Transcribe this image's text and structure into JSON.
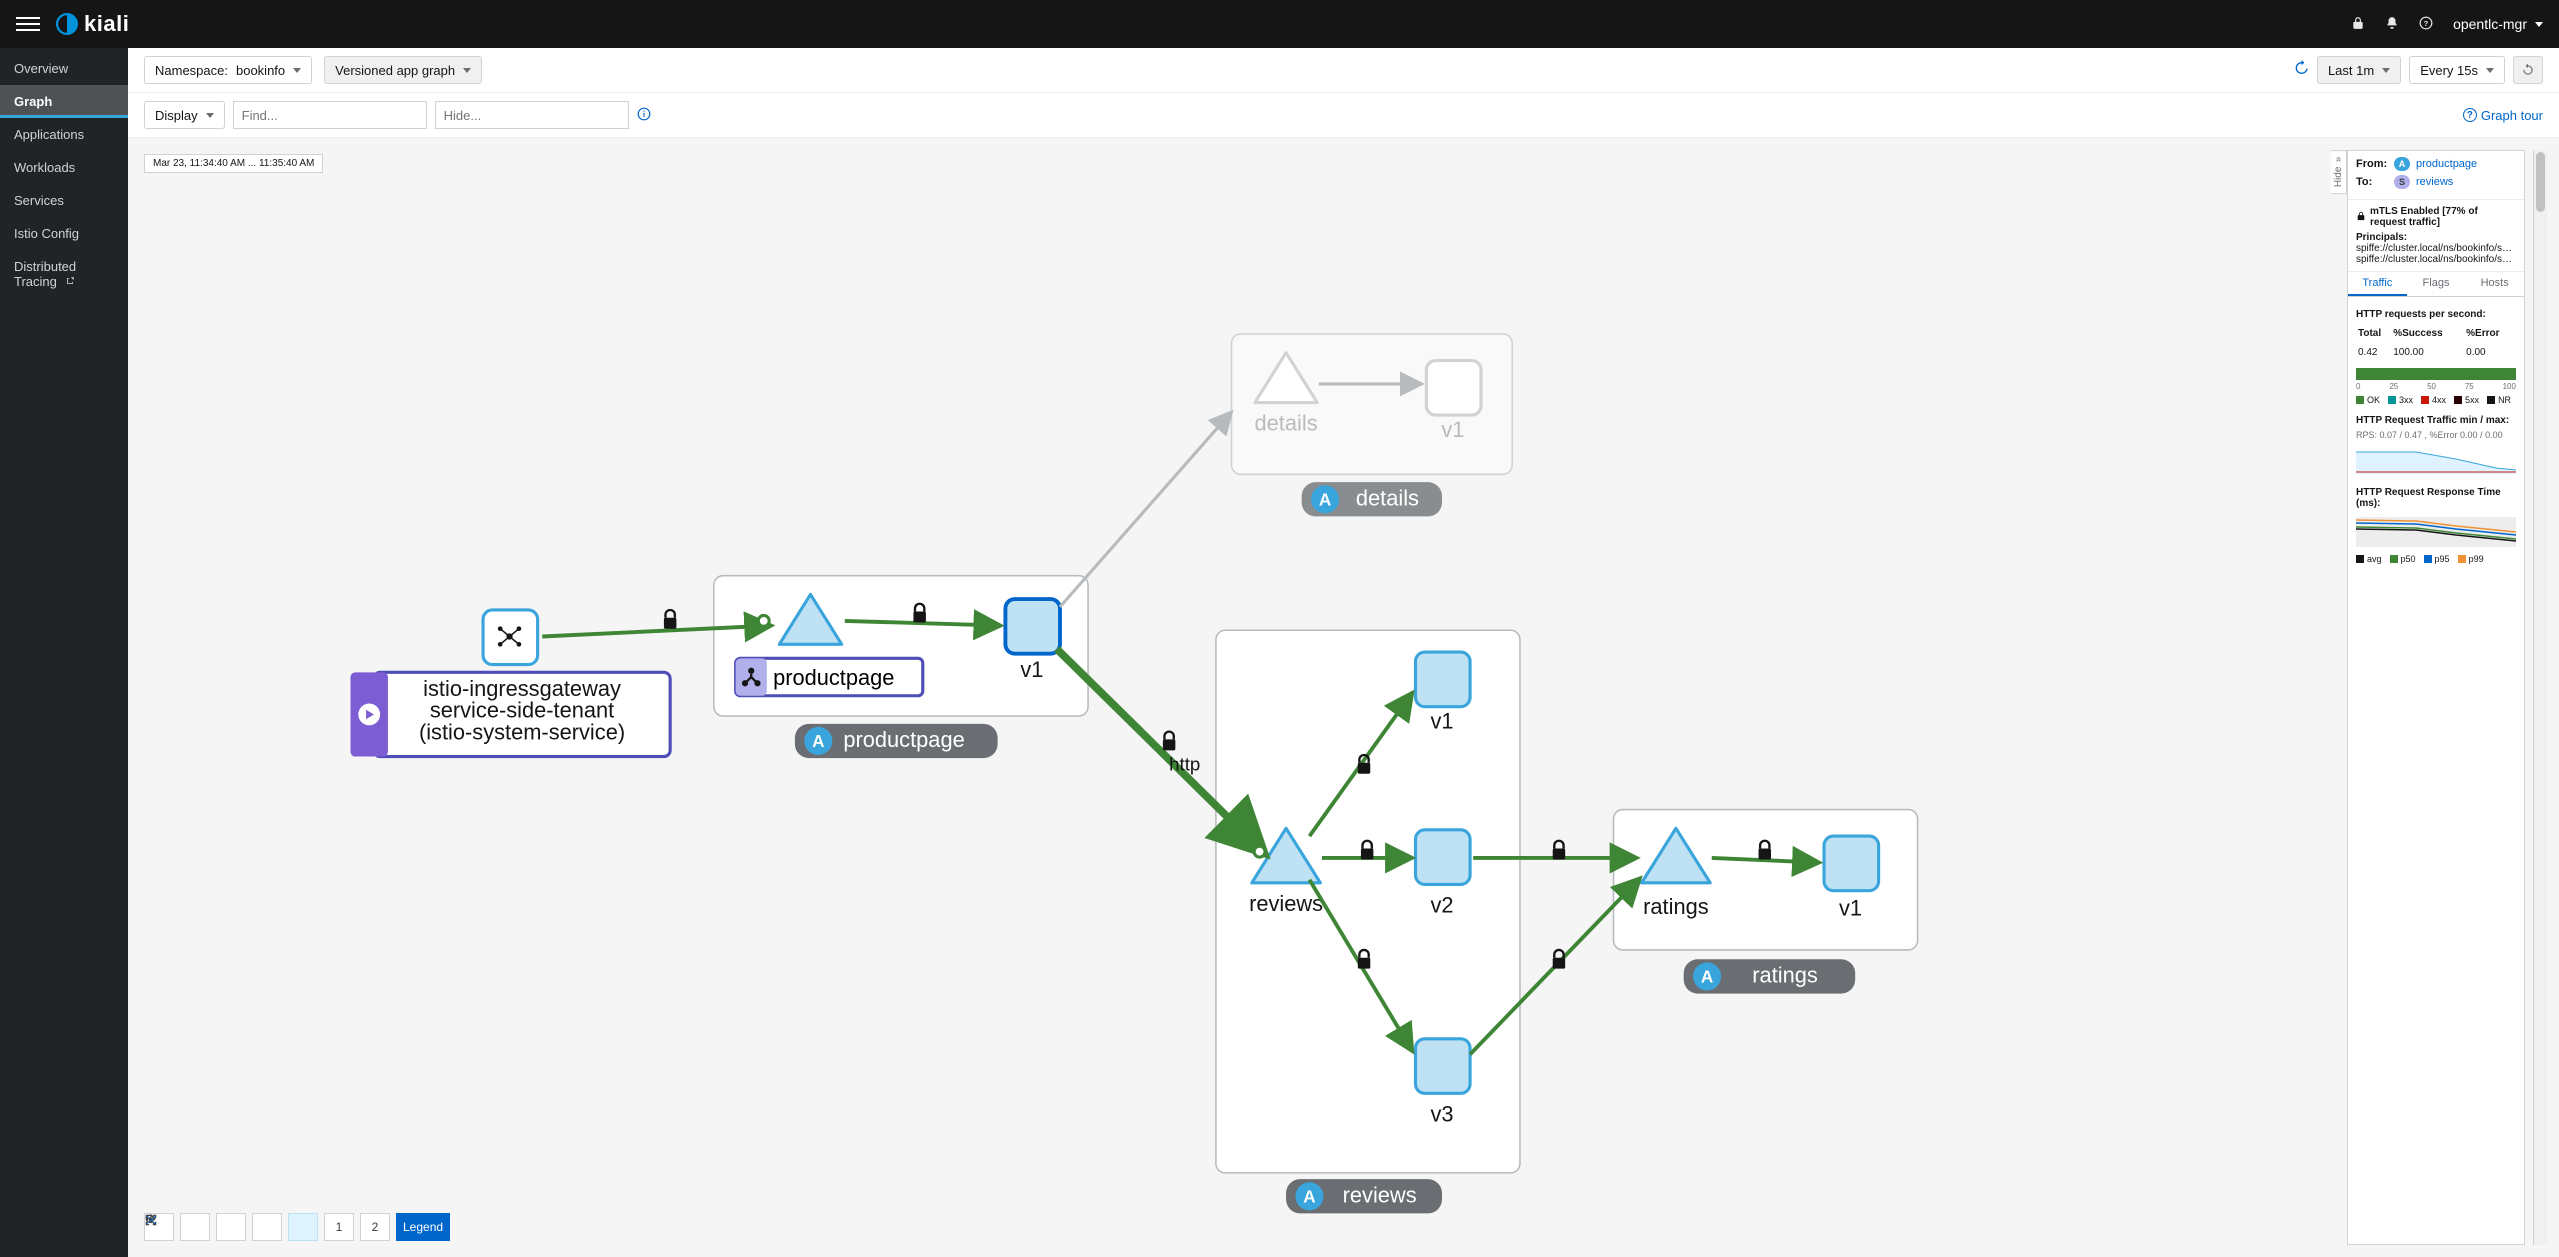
{
  "app": {
    "name": "kiali"
  },
  "topbar": {
    "user": "opentlc-mgr",
    "icons": [
      "lock-icon",
      "bell-icon",
      "help-icon"
    ]
  },
  "sidebar": {
    "items": [
      {
        "label": "Overview",
        "key": "overview"
      },
      {
        "label": "Graph",
        "key": "graph",
        "active": true
      },
      {
        "label": "Applications",
        "key": "applications"
      },
      {
        "label": "Workloads",
        "key": "workloads"
      },
      {
        "label": "Services",
        "key": "services"
      },
      {
        "label": "Istio Config",
        "key": "istio-config"
      },
      {
        "label": "Distributed Tracing",
        "key": "distributed-tracing",
        "external": true
      }
    ]
  },
  "toolbar": {
    "namespace_label": "Namespace:",
    "namespace_value": "bookinfo",
    "graph_type": "Versioned app graph",
    "display_label": "Display",
    "find_placeholder": "Find...",
    "hide_placeholder": "Hide...",
    "time_range": "Last 1m",
    "refresh_interval": "Every 15s",
    "graph_tour": "Graph tour"
  },
  "canvas": {
    "timestamp_text": "Mar 23, 11:34:40 AM ... 11:35:40 AM",
    "ingress": {
      "line1": "istio-ingressgateway",
      "line2": "service-side-tenant",
      "line3": "(istio-system-service)"
    },
    "productpage": {
      "service_label": "productpage",
      "v1": "v1",
      "group": "productpage"
    },
    "details": {
      "service_label": "details",
      "v1": "v1",
      "group": "details"
    },
    "reviews": {
      "service_label": "reviews",
      "v1": "v1",
      "v2": "v2",
      "v3": "v3",
      "group": "reviews"
    },
    "ratings": {
      "service_label": "ratings",
      "v1": "v1",
      "group": "ratings"
    },
    "edge_http_label": "http",
    "badge_a": "A",
    "badge_s": "S",
    "bottom_toolbar": {
      "legend": "Legend",
      "layout1_suffix": "1",
      "layout2_suffix": "2"
    }
  },
  "sidepanel": {
    "hide_label": "Hide",
    "from_label": "From:",
    "to_label": "To:",
    "from_value": "productpage",
    "to_value": "reviews",
    "from_badge": "A",
    "to_badge": "S",
    "mtls_text": "mTLS Enabled [77% of request traffic]",
    "principals_label": "Principals:",
    "principals": [
      "spiffe://cluster.local/ns/bookinfo/sa/bookinfo...",
      "spiffe://cluster.local/ns/bookinfo/sa/bookinfo..."
    ],
    "tabs": [
      {
        "label": "Traffic",
        "active": true
      },
      {
        "label": "Flags",
        "active": false
      },
      {
        "label": "Hosts",
        "active": false
      }
    ],
    "traffic": {
      "title": "HTTP requests per second:",
      "headers": {
        "total": "Total",
        "success": "%Success",
        "error": "%Error"
      },
      "row": {
        "total": "0.42",
        "success": "100.00",
        "error": "0.00"
      },
      "xaxis": [
        "0",
        "25",
        "50",
        "75",
        "100"
      ],
      "legend_codes": [
        {
          "label": "OK",
          "color": "#3e8635"
        },
        {
          "label": "3xx",
          "color": "#009596"
        },
        {
          "label": "4xx",
          "color": "#c9190b"
        },
        {
          "label": "5xx",
          "color": "#2b0000"
        },
        {
          "label": "NR",
          "color": "#151515"
        }
      ],
      "minmax_title": "HTTP Request Traffic min / max:",
      "minmax_sub": "RPS: 0.07 / 0.47 , %Error 0.00 / 0.00",
      "rt_title": "HTTP Request Response Time (ms):",
      "rt_legend": [
        {
          "label": "avg",
          "color": "#151515"
        },
        {
          "label": "p50",
          "color": "#3e8635"
        },
        {
          "label": "p95",
          "color": "#0066cc"
        },
        {
          "label": "p99",
          "color": "#ef9234"
        }
      ]
    }
  },
  "chart_data": [
    {
      "type": "bar",
      "title": "HTTP requests per second: distribution",
      "orientation": "horizontal-stacked-percent",
      "categories": [
        "OK",
        "3xx",
        "4xx",
        "5xx",
        "NR"
      ],
      "values": [
        100,
        0,
        0,
        0,
        0
      ],
      "xlim": [
        0,
        100
      ],
      "xticks": [
        0,
        25,
        50,
        75,
        100
      ]
    },
    {
      "type": "area",
      "title": "HTTP Request Traffic min / max",
      "ylabel": "RPS",
      "series": [
        {
          "name": "RPS",
          "values": [
            0.45,
            0.45,
            0.44,
            0.42,
            0.38,
            0.3,
            0.2,
            0.12,
            0.09,
            0.08
          ]
        }
      ],
      "x_relative_minutes": [
        -1.0,
        -0.9,
        -0.8,
        -0.7,
        -0.6,
        -0.5,
        -0.4,
        -0.3,
        -0.2,
        -0.1
      ],
      "ymin_line": 0.07,
      "ymax_line": 0.47
    },
    {
      "type": "line",
      "title": "HTTP Request Response Time (ms)",
      "series": [
        {
          "name": "avg",
          "values": [
            28,
            28,
            27,
            26,
            24,
            22,
            20,
            19,
            18,
            18
          ]
        },
        {
          "name": "p50",
          "values": [
            27,
            27,
            26,
            25,
            23,
            21,
            19,
            18,
            17,
            17
          ]
        },
        {
          "name": "p95",
          "values": [
            42,
            42,
            41,
            40,
            37,
            34,
            31,
            29,
            28,
            27
          ]
        },
        {
          "name": "p99",
          "values": [
            55,
            55,
            54,
            53,
            49,
            45,
            41,
            38,
            36,
            35
          ]
        }
      ],
      "x_relative_minutes": [
        -1.0,
        -0.9,
        -0.8,
        -0.7,
        -0.6,
        -0.5,
        -0.4,
        -0.3,
        -0.2,
        -0.1
      ]
    }
  ]
}
